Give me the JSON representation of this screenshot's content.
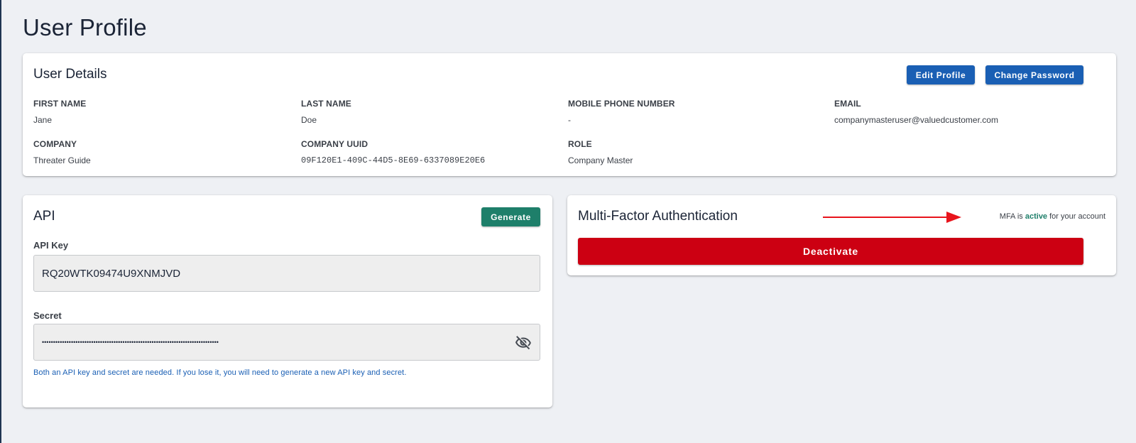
{
  "page": {
    "title": "User Profile"
  },
  "user_details": {
    "title": "User Details",
    "edit_profile_label": "Edit Profile",
    "change_password_label": "Change Password",
    "fields": {
      "first_name": {
        "label": "FIRST NAME",
        "value": "Jane"
      },
      "last_name": {
        "label": "LAST NAME",
        "value": "Doe"
      },
      "mobile": {
        "label": "MOBILE PHONE NUMBER",
        "value": "-"
      },
      "email": {
        "label": "EMAIL",
        "value": "companymasteruser@valuedcustomer.com"
      },
      "company": {
        "label": "COMPANY",
        "value": "Threater Guide"
      },
      "company_uuid": {
        "label": "COMPANY UUID",
        "value": "09F120E1-409C-44D5-8E69-6337089E20E6"
      },
      "role": {
        "label": "ROLE",
        "value": "Company Master"
      }
    }
  },
  "api": {
    "title": "API",
    "generate_label": "Generate",
    "api_key_label": "API Key",
    "api_key_value": "RQ20WTK09474U9XNMJVD",
    "secret_label": "Secret",
    "secret_value": "•••••••••••••••••••••••••••••••••••••••••••••••••••••••••••••••••••••••••••••••",
    "hint": "Both an API key and secret are needed. If you lose it, you will need to generate a new API key and secret.",
    "secret_toggle_icon": "eye-off-icon"
  },
  "mfa": {
    "title": "Multi-Factor Authentication",
    "status_prefix": "MFA is",
    "status_word": "active",
    "status_suffix": "for your account",
    "deactivate_label": "Deactivate"
  },
  "colors": {
    "background": "#eef0f4",
    "primary_blue": "#1a5fb4",
    "green": "#1e7f6a",
    "danger_red": "#cc0012",
    "annotation_arrow": "#e8141c"
  }
}
